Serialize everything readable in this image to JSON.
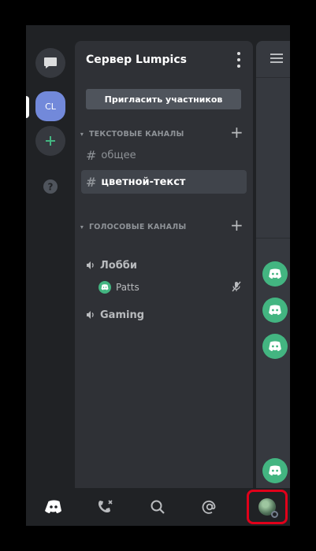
{
  "server": {
    "name": "Сервер Lumpics",
    "initials": "CL",
    "invite_label": "Пригласить участников"
  },
  "categories": {
    "text": "ТЕКСТОВЫЕ КАНАЛЫ",
    "voice": "ГОЛОСОВЫЕ КАНАЛЫ"
  },
  "text_channels": [
    {
      "name": "общее",
      "active": false
    },
    {
      "name": "цветной-текст",
      "active": true
    }
  ],
  "voice_channels": [
    {
      "name": "Лобби",
      "users": [
        {
          "name": "Patts",
          "muted": true
        }
      ]
    },
    {
      "name": "Gaming",
      "users": []
    }
  ],
  "bottom_nav": [
    "home-icon",
    "friends-icon",
    "search-icon",
    "mentions-icon",
    "profile-avatar"
  ],
  "colors": {
    "blurple": "#7289da",
    "green": "#43b581",
    "highlight_red": "#e0001a"
  }
}
